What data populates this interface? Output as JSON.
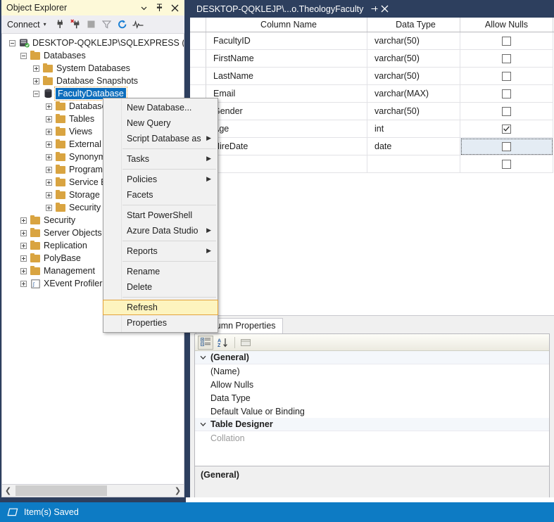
{
  "object_explorer": {
    "title": "Object Explorer",
    "title_buttons": [
      {
        "name": "dropdown",
        "glyph": "▾"
      },
      {
        "name": "pin",
        "glyph": "⊣"
      },
      {
        "name": "close",
        "glyph": "✕"
      }
    ],
    "toolbar": {
      "connect_label": "Connect",
      "connect_caret": "▼",
      "icons": [
        {
          "name": "connect-icon"
        },
        {
          "name": "disconnect-icon"
        },
        {
          "name": "stop-icon"
        },
        {
          "name": "filter-icon"
        },
        {
          "name": "refresh-icon"
        },
        {
          "name": "activity-monitor-icon"
        }
      ]
    },
    "tree": [
      {
        "label": "DESKTOP-QQKLEJP\\SQLEXPRESS (SQL S",
        "level": 0,
        "icon": "server",
        "expanded": true
      },
      {
        "label": "Databases",
        "level": 1,
        "icon": "folder",
        "expanded": true
      },
      {
        "label": "System Databases",
        "level": 2,
        "icon": "folder",
        "expanded": false
      },
      {
        "label": "Database Snapshots",
        "level": 2,
        "icon": "folder",
        "expanded": false
      },
      {
        "label": "FacultyDatabase",
        "level": 2,
        "icon": "database",
        "expanded": true,
        "selected": true
      },
      {
        "label": "Database I",
        "level": 3,
        "icon": "folder",
        "expanded": false
      },
      {
        "label": "Tables",
        "level": 3,
        "icon": "folder",
        "expanded": false
      },
      {
        "label": "Views",
        "level": 3,
        "icon": "folder",
        "expanded": false
      },
      {
        "label": "External Re",
        "level": 3,
        "icon": "folder",
        "expanded": false
      },
      {
        "label": "Synonyms",
        "level": 3,
        "icon": "folder",
        "expanded": false
      },
      {
        "label": "Programm",
        "level": 3,
        "icon": "folder",
        "expanded": false
      },
      {
        "label": "Service Bro",
        "level": 3,
        "icon": "folder",
        "expanded": false
      },
      {
        "label": "Storage",
        "level": 3,
        "icon": "folder",
        "expanded": false
      },
      {
        "label": "Security",
        "level": 3,
        "icon": "folder",
        "expanded": false
      },
      {
        "label": "Security",
        "level": 1,
        "icon": "folder",
        "expanded": false
      },
      {
        "label": "Server Objects",
        "level": 1,
        "icon": "folder",
        "expanded": false
      },
      {
        "label": "Replication",
        "level": 1,
        "icon": "folder",
        "expanded": false
      },
      {
        "label": "PolyBase",
        "level": 1,
        "icon": "folder",
        "expanded": false
      },
      {
        "label": "Management",
        "level": 1,
        "icon": "folder",
        "expanded": false
      },
      {
        "label": "XEvent Profiler",
        "level": 1,
        "icon": "xevent",
        "expanded": false
      }
    ],
    "hscroll": {
      "left_arrow": "❮",
      "right_arrow": "❯"
    }
  },
  "document": {
    "tab": {
      "title": "DESKTOP-QQKLEJP\\...o.TheologyFaculty",
      "pin_glyph": "⊣",
      "close_glyph": "✕"
    },
    "grid": {
      "headers": [
        "",
        "Column Name",
        "Data Type",
        "Allow Nulls"
      ],
      "rows": [
        {
          "name": "FacultyID",
          "type": "varchar(50)",
          "allow_nulls": false,
          "focused": false
        },
        {
          "name": "FirstName",
          "type": "varchar(50)",
          "allow_nulls": false,
          "focused": false
        },
        {
          "name": "LastName",
          "type": "varchar(50)",
          "allow_nulls": false,
          "focused": false
        },
        {
          "name": "Email",
          "type": "varchar(MAX)",
          "allow_nulls": false,
          "focused": false
        },
        {
          "name": "Gender",
          "type": "varchar(50)",
          "allow_nulls": false,
          "focused": false
        },
        {
          "name": "Age",
          "type": "int",
          "allow_nulls": true,
          "focused": false
        },
        {
          "name": "HireDate",
          "type": "date",
          "allow_nulls": false,
          "focused": true
        },
        {
          "name": "",
          "type": "",
          "allow_nulls": false,
          "focused": false
        }
      ]
    }
  },
  "column_properties": {
    "tab_label": "Column Properties",
    "toolbar_icons": [
      {
        "name": "categorized-icon"
      },
      {
        "name": "alphabetic-sort-icon"
      },
      {
        "name": "property-pages-icon"
      }
    ],
    "rows": [
      {
        "label": "(General)",
        "type": "group",
        "twisty": "⌄"
      },
      {
        "label": "(Name)",
        "type": "child"
      },
      {
        "label": "Allow Nulls",
        "type": "child"
      },
      {
        "label": "Data Type",
        "type": "child"
      },
      {
        "label": "Default Value or Binding",
        "type": "child"
      },
      {
        "label": "Table Designer",
        "type": "group",
        "twisty": "⌄"
      },
      {
        "label": "Collation",
        "type": "child",
        "disabled": true
      }
    ],
    "description_title": "(General)"
  },
  "context_menu": {
    "items": [
      {
        "label": "New Database...",
        "submenu": false
      },
      {
        "label": "New Query",
        "submenu": false
      },
      {
        "label": "Script Database as",
        "submenu": true
      },
      {
        "separator": true
      },
      {
        "label": "Tasks",
        "submenu": true
      },
      {
        "separator": true
      },
      {
        "label": "Policies",
        "submenu": true
      },
      {
        "label": "Facets",
        "submenu": false
      },
      {
        "separator": true
      },
      {
        "label": "Start PowerShell",
        "submenu": false
      },
      {
        "label": "Azure Data Studio",
        "submenu": true
      },
      {
        "separator": true
      },
      {
        "label": "Reports",
        "submenu": true
      },
      {
        "separator": true
      },
      {
        "label": "Rename",
        "submenu": false
      },
      {
        "label": "Delete",
        "submenu": false
      },
      {
        "separator": true
      },
      {
        "label": "Refresh",
        "submenu": false,
        "highlighted": true
      },
      {
        "label": "Properties",
        "submenu": false
      }
    ],
    "submenu_arrow": "▶"
  },
  "statusbar": {
    "icon": "saved-item-icon",
    "text": "Item(s) Saved"
  },
  "colors": {
    "accent_blue": "#0d7bc4",
    "panel_chrome": "#2d3f5e",
    "title_highlight": "#fdf9d8",
    "menu_highlight": "#fdf4bf",
    "menu_highlight_border": "#e3a23b",
    "selection_blue": "#0d6ebd",
    "folder_gold": "#d9a441"
  }
}
